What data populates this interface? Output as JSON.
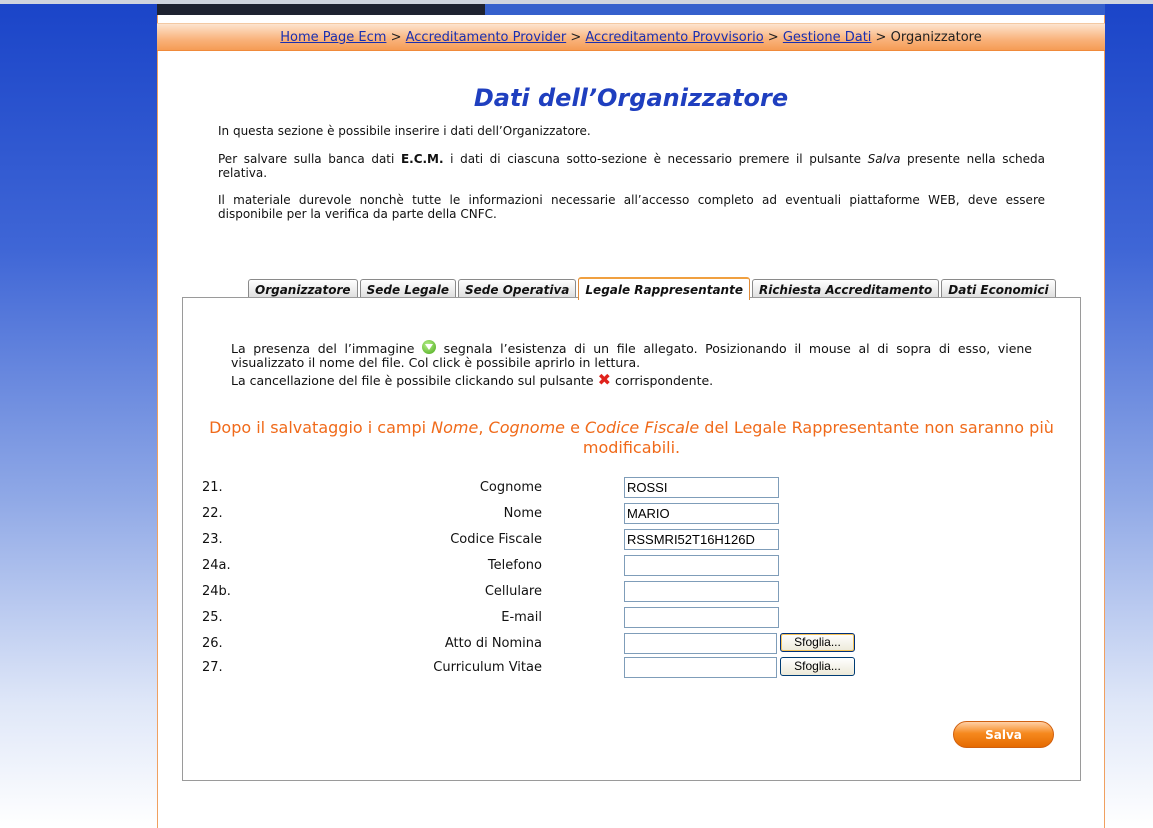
{
  "breadcrumb": {
    "items": [
      "Home Page Ecm",
      "Accreditamento Provider",
      "Accreditamento Provvisorio",
      "Gestione Dati"
    ],
    "separator": ">",
    "current": "Organizzatore"
  },
  "page": {
    "title": "Dati dell’Organizzatore",
    "intro_1": "In questa sezione è possibile inserire i dati dell’Organizzatore.",
    "intro_2_a": "Per salvare sulla banca dati ",
    "intro_2_bold": "E.C.M.",
    "intro_2_b": " i dati di ciascuna sotto-sezione è necessario premere il pulsante ",
    "intro_2_italic": "Salva",
    "intro_2_c": " presente nella scheda relativa.",
    "intro_3": "Il materiale durevole nonchè tutte le informazioni necessarie all’accesso completo ad eventuali piattaforme WEB, deve essere disponibile per la verifica da parte della CNFC."
  },
  "tabs": [
    {
      "label": "Organizzatore",
      "active": false
    },
    {
      "label": "Sede Legale",
      "active": false
    },
    {
      "label": "Sede Operativa",
      "active": false
    },
    {
      "label": "Legale Rappresentante",
      "active": true
    },
    {
      "label": "Richiesta Accreditamento",
      "active": false
    },
    {
      "label": "Dati Economici",
      "active": false
    }
  ],
  "panel": {
    "note_1a": "La presenza del l’immagine ",
    "note_1b": " segnala l’esistenza di un file allegato. Posizionando il mouse al di sopra di esso, viene visualizzato il nome del file. Col click è possibile aprirlo in lettura.",
    "note_2a": "La cancellazione del file è possibile clickando sul pulsante ",
    "note_2b": " corrispondente.",
    "warn_a": "Dopo il salvataggio i campi ",
    "warn_i1": "Nome",
    "warn_b": ", ",
    "warn_i2": "Cognome",
    "warn_c": " e ",
    "warn_i3": "Codice Fiscale",
    "warn_d": " del Legale Rappresentante non saranno più modificabili.",
    "colors": {
      "warning": "#f06a1a",
      "title": "#1f3fbf"
    }
  },
  "fields": [
    {
      "num": "21.",
      "label": "Cognome",
      "value": "ROSSI"
    },
    {
      "num": "22.",
      "label": "Nome",
      "value": "MARIO"
    },
    {
      "num": "23.",
      "label": "Codice Fiscale",
      "value": "RSSMRI52T16H126D"
    },
    {
      "num": "24a.",
      "label": "Telefono",
      "value": ""
    },
    {
      "num": "24b.",
      "label": "Cellulare",
      "value": ""
    },
    {
      "num": "25.",
      "label": "E-mail",
      "value": ""
    },
    {
      "num": "26.",
      "label": "Atto di Nomina",
      "value": "",
      "browse": "Sfoglia..."
    },
    {
      "num": "27.",
      "label": "Curriculum Vitae",
      "value": "",
      "browse": "Sfoglia..."
    }
  ],
  "save_label": "Salva",
  "icons": {
    "attachment": "green-down-arrow-icon",
    "delete": "red-x-icon"
  }
}
